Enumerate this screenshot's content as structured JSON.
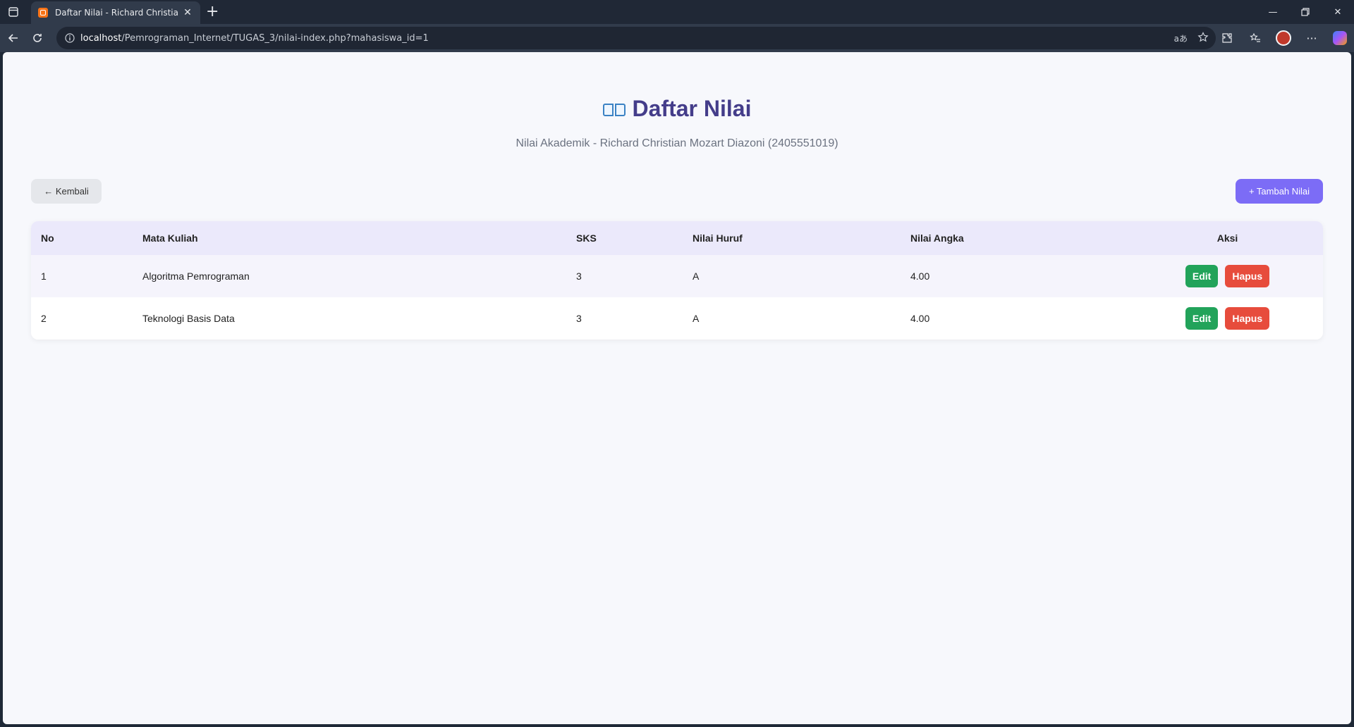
{
  "browser": {
    "tab_title": "Daftar Nilai - Richard Christian Mozart Diazoni",
    "url_host": "localhost",
    "url_path": "/Pemrograman_Internet/TUGAS_3/nilai-index.php?mahasiswa_id=1",
    "read_aloud_label": "aあ"
  },
  "page": {
    "title": "Daftar Nilai",
    "subtitle": "Nilai Akademik - Richard Christian Mozart Diazoni (2405551019)",
    "back_label": "← Kembali",
    "add_label": "+ Tambah Nilai"
  },
  "table": {
    "headers": [
      "No",
      "Mata Kuliah",
      "SKS",
      "Nilai Huruf",
      "Nilai Angka",
      "Aksi"
    ],
    "rows": [
      {
        "no": "1",
        "mata_kuliah": "Algoritma Pemrograman",
        "sks": "3",
        "nilai_huruf": "A",
        "nilai_angka": "4.00"
      },
      {
        "no": "2",
        "mata_kuliah": "Teknologi Basis Data",
        "sks": "3",
        "nilai_huruf": "A",
        "nilai_angka": "4.00"
      }
    ],
    "edit_label": "Edit",
    "hapus_label": "Hapus"
  },
  "colors": {
    "title": "#443d8a",
    "add_button": "#7c6cf6",
    "edit_button": "#22a35a",
    "hapus_button": "#e74c3c",
    "header_bg": "#ebe9fb"
  }
}
